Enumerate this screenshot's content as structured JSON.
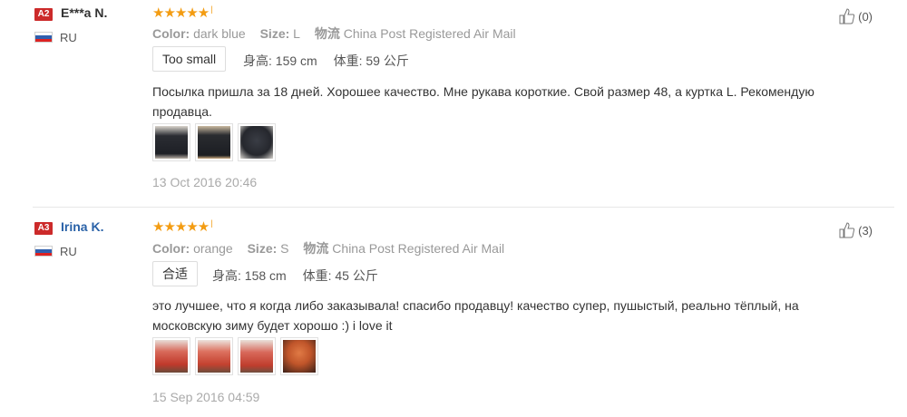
{
  "reviews": [
    {
      "rank": "A2",
      "user": "E***a N.",
      "country": "RU",
      "rating_stars": 5,
      "color_label": "Color:",
      "color_value": "dark blue",
      "size_label": "Size:",
      "size_value": "L",
      "shipping_label": "物流",
      "shipping_value": "China Post Registered Air Mail",
      "fit": "Too small",
      "height_label": "身高:",
      "height_value": "159 cm",
      "weight_label": "体重:",
      "weight_value": "59 公斤",
      "text_line1": "Посылка пришла за 18 дней. Хорошее качество. Мне рукава короткие. Свой размер 48, а куртка L. Рекомендую",
      "text_line2": "продавца.",
      "photo_count": 3,
      "date": "13 Oct 2016 20:46",
      "likes": "(0)"
    },
    {
      "rank": "A3",
      "user": "Irina K.",
      "country": "RU",
      "rating_stars": 5,
      "color_label": "Color:",
      "color_value": "orange",
      "size_label": "Size:",
      "size_value": "S",
      "shipping_label": "物流",
      "shipping_value": "China Post Registered Air Mail",
      "fit": "合适",
      "height_label": "身高:",
      "height_value": "158 cm",
      "weight_label": "体重:",
      "weight_value": "45 公斤",
      "text_line1": "это лучшее, что я когда либо заказывала! спасибо продавцу! качество супер, пушыстый, реально тёплый, на",
      "text_line2": "московскую зиму будет хорошо :) i love it",
      "photo_count": 4,
      "date": "15 Sep 2016 04:59",
      "likes": "(3)"
    }
  ],
  "icons": {
    "like": "thumbs-up-icon",
    "flag": "russia-flag-icon",
    "star": "star-icon"
  },
  "colors": {
    "rank_badge": "#cc2a2a",
    "stars": "#f39c12",
    "link_user": "#2a62a8"
  }
}
